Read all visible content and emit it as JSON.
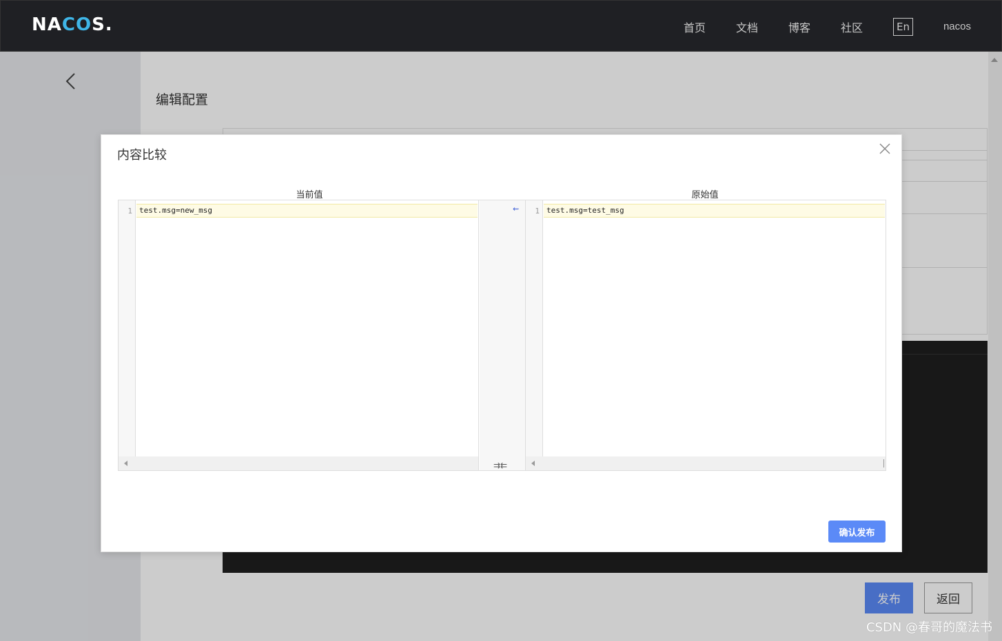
{
  "header": {
    "logo_left": "NA",
    "logo_mid": "CO",
    "logo_right": "S.",
    "nav": [
      "首页",
      "文档",
      "博客",
      "社区"
    ],
    "lang": "En",
    "user": "nacos"
  },
  "page": {
    "title": "编辑配置",
    "publish_label": "发布",
    "return_label": "返回"
  },
  "dialog": {
    "title": "内容比较",
    "left_label": "当前值",
    "right_label": "原始值",
    "left_lines": [
      {
        "no": "1",
        "text": "test.msg=new_msg"
      }
    ],
    "right_lines": [
      {
        "no": "1",
        "text": "test.msg=test_msg"
      }
    ],
    "merge_arrow": "⇜",
    "swap_icon": "⇉⇇",
    "confirm_label": "确认发布"
  },
  "watermark": "CSDN @春哥的魔法书",
  "colors": {
    "primary": "#5b8af7",
    "header_bg": "#1f2024",
    "diff_highlight": "#fefbe5"
  }
}
